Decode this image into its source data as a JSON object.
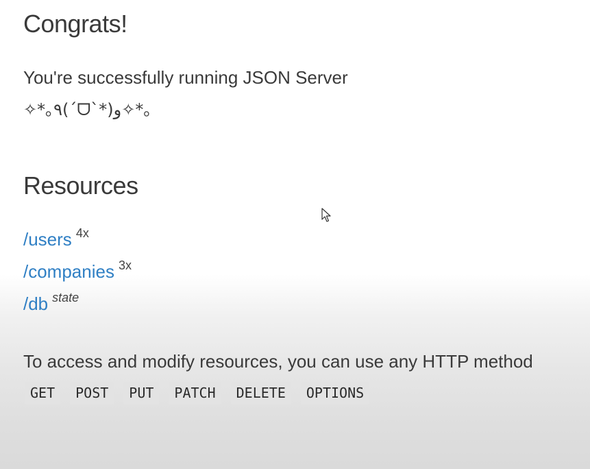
{
  "header": {
    "title": "Congrats!",
    "message": "You're successfully running JSON Server",
    "kaomoji": "✧*｡٩(ˊᗜˋ*)و✧*｡"
  },
  "resources": {
    "title": "Resources",
    "items": [
      {
        "path": "/users",
        "note": "4x"
      },
      {
        "path": "/companies",
        "note": "3x"
      },
      {
        "path": "/db",
        "note": "state"
      }
    ]
  },
  "access": {
    "text": "To access and modify resources, you can use any HTTP method",
    "methods": [
      "GET",
      "POST",
      "PUT",
      "PATCH",
      "DELETE",
      "OPTIONS"
    ]
  },
  "icons": {
    "cursor": "mouse-pointer-icon"
  },
  "colors": {
    "link": "#2f7fc4",
    "text": "#3a3a3a",
    "method_bg": "#e3e3e3"
  }
}
